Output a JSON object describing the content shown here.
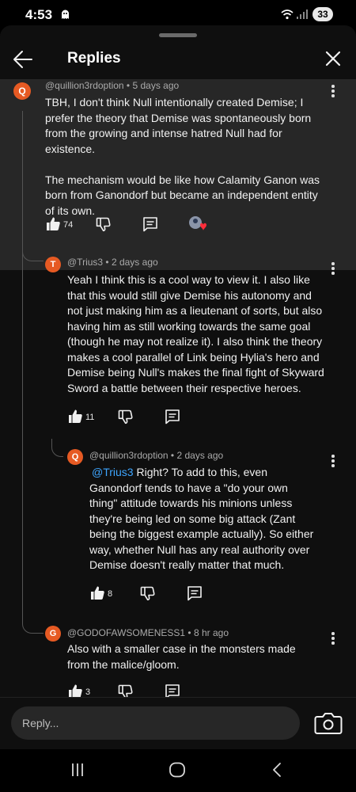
{
  "status_bar": {
    "time": "4:53",
    "battery": "33"
  },
  "header": {
    "title": "Replies"
  },
  "comments": [
    {
      "avatar_letter": "Q",
      "avatar_color": "#e65a23",
      "author": "@quillion3rdoption",
      "age": "5 days ago",
      "text": "TBH, I don't think Null intentionally created Demise; I prefer the theory that Demise was spontaneously born from the growing and intense hatred Null had for existence.\n\nThe mechanism would be like how Calamity Ganon was born from Ganondorf but became an independent entity of its own.",
      "likes": "74"
    },
    {
      "avatar_letter": "T",
      "avatar_color": "#e65a23",
      "author": "@Trius3",
      "age": "2 days ago",
      "text": "Yeah I think this is a cool way to view it. I also like that this would still give Demise his autonomy and not just making him as a lieutenant of sorts, but also having him as still working towards the same goal (though he may not realize it). I also think the theory makes a cool parallel of Link being Hylia's hero and Demise being Null's makes the final fight of Skyward Sword a battle between their respective heroes.",
      "likes": "11"
    },
    {
      "avatar_letter": "Q",
      "avatar_color": "#e65a23",
      "author": "@quillion3rdoption",
      "age": "2 days ago",
      "mention": "@Trius3",
      "text": " Right? To add to this, even Ganondorf tends to have a \"do your own thing\" attitude towards his minions unless they're being led on some big attack (Zant being the biggest example actually). So either way, whether Null has any real authority over Demise doesn't really matter that much.",
      "likes": "8"
    },
    {
      "avatar_letter": "G",
      "avatar_color": "#e65a23",
      "author": "@GODOFAWSOMENESS1",
      "age": "8 hr ago",
      "text": "Also with a smaller case in the monsters made from the malice/gloom.",
      "likes": "3"
    }
  ],
  "reply_bar": {
    "placeholder": "Reply..."
  },
  "icons": {
    "back": "arrow-left-icon",
    "close": "close-icon",
    "like": "thumbs-up-icon",
    "dislike": "thumbs-down-icon",
    "reply": "reply-icon",
    "more": "more-vertical-icon",
    "camera": "camera-icon"
  }
}
